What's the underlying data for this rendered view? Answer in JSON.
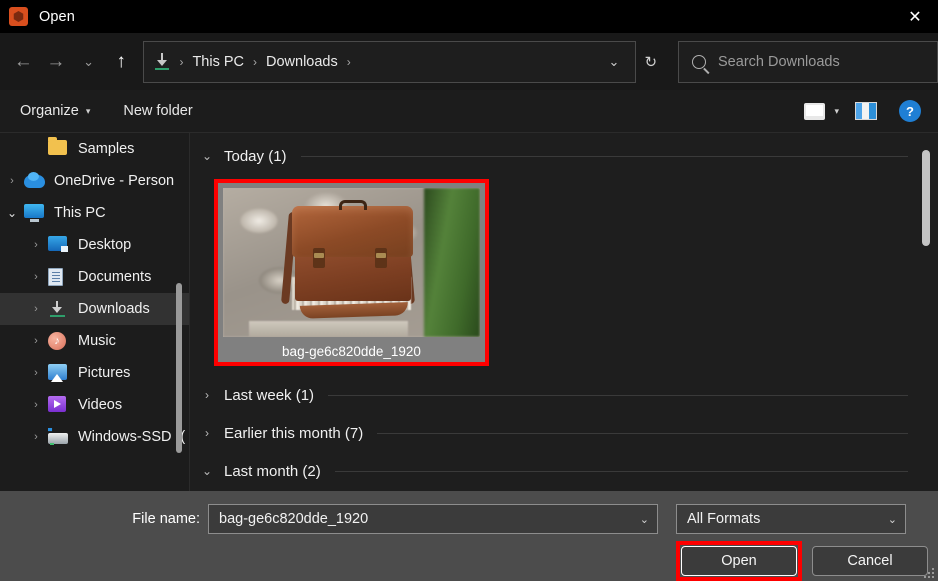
{
  "window": {
    "title": "Open",
    "app_icon": "gimp-hexagon-icon",
    "close_label": "✕"
  },
  "nav": {
    "back": "←",
    "forward": "→",
    "recent": "⌄",
    "up": "↑",
    "breadcrumb": {
      "root_icon": "downloads-arrow-icon",
      "separator": "›",
      "items": [
        "This PC",
        "Downloads"
      ],
      "trailing_separator": "›",
      "dropdown": "⌄",
      "refresh": "↻"
    },
    "search": {
      "placeholder": "Search Downloads",
      "icon": "search-icon"
    }
  },
  "toolbar": {
    "organize": "Organize",
    "organize_caret": "▾",
    "new_folder": "New folder",
    "view_icon": "view-layout-icon",
    "view_caret": "▾",
    "preview_pane_icon": "preview-pane-icon",
    "help_icon": "?"
  },
  "sidebar": {
    "items": [
      {
        "label": "Samples",
        "icon": "folder-icon",
        "chevron": "",
        "indent": 2,
        "selected": false
      },
      {
        "label": "OneDrive - Person",
        "icon": "onedrive-cloud-icon",
        "chevron": "›",
        "indent": 0,
        "selected": false
      },
      {
        "label": "This PC",
        "icon": "this-pc-icon",
        "chevron": "⌄",
        "indent": 0,
        "selected": false
      },
      {
        "label": "Desktop",
        "icon": "desktop-icon",
        "chevron": "›",
        "indent": 1,
        "selected": false
      },
      {
        "label": "Documents",
        "icon": "documents-icon",
        "chevron": "›",
        "indent": 1,
        "selected": false
      },
      {
        "label": "Downloads",
        "icon": "downloads-icon",
        "chevron": "›",
        "indent": 1,
        "selected": true
      },
      {
        "label": "Music",
        "icon": "music-icon",
        "chevron": "›",
        "indent": 1,
        "selected": false
      },
      {
        "label": "Pictures",
        "icon": "pictures-icon",
        "chevron": "›",
        "indent": 1,
        "selected": false
      },
      {
        "label": "Videos",
        "icon": "videos-icon",
        "chevron": "›",
        "indent": 1,
        "selected": false
      },
      {
        "label": "Windows-SSD ((",
        "icon": "drive-icon",
        "chevron": "›",
        "indent": 1,
        "selected": false
      }
    ]
  },
  "files": {
    "groups": [
      {
        "label": "Today (1)",
        "chevron": "⌄",
        "expanded": true
      },
      {
        "label": "Last week (1)",
        "chevron": "›",
        "expanded": false
      },
      {
        "label": "Earlier this month (7)",
        "chevron": "›",
        "expanded": false
      },
      {
        "label": "Last month (2)",
        "chevron": "⌄",
        "expanded": true
      }
    ],
    "selected_file": {
      "name": "bag-ge6c820dde_1920",
      "thumbnail": "brown-leather-messenger-bag-photo",
      "selected": true,
      "highlight_color": "#fe0000"
    }
  },
  "bottom": {
    "file_name_label": "File name:",
    "file_name_value": "bag-ge6c820dde_1920",
    "file_name_caret": "⌄",
    "format_value": "All Formats",
    "format_caret": "⌄",
    "open_button": "Open",
    "cancel_button": "Cancel",
    "open_highlight_color": "#fe0000"
  }
}
